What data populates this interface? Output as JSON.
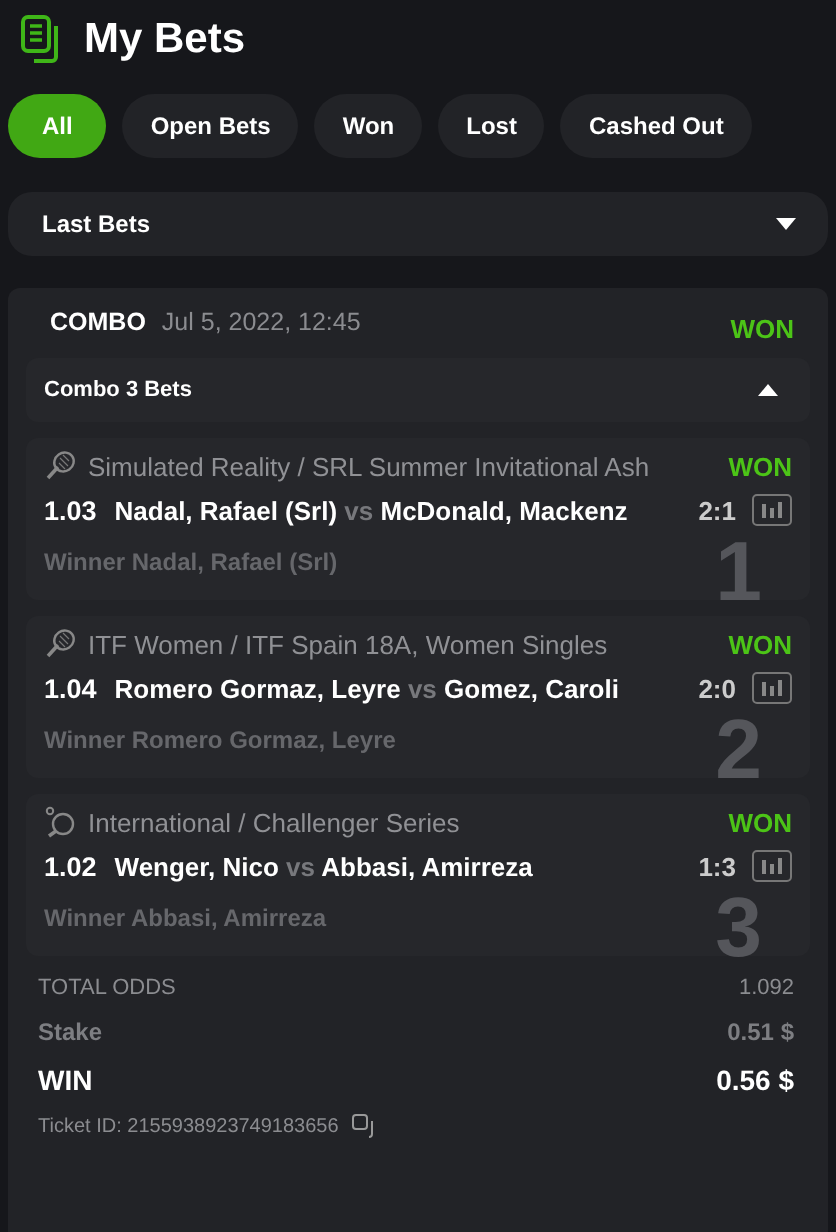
{
  "header": {
    "title": "My Bets"
  },
  "tabs": [
    {
      "label": "All",
      "selected": true
    },
    {
      "label": "Open Bets",
      "selected": false
    },
    {
      "label": "Won",
      "selected": false
    },
    {
      "label": "Lost",
      "selected": false
    },
    {
      "label": "Cashed Out",
      "selected": false
    }
  ],
  "filter": {
    "value": "Last Bets"
  },
  "bet": {
    "type": "COMBO",
    "date": "Jul 5, 2022, 12:45",
    "status": "WON",
    "group": {
      "label": "Combo 3 Bets",
      "expanded": true
    },
    "legs": [
      {
        "kind": "tennis",
        "tournament": "Simulated Reality / SRL Summer Invitational Ash",
        "status": "WON",
        "odds": "1.03",
        "home": "Nadal, Rafael (Srl)",
        "vs": "vs",
        "away": "McDonald, Mackenz",
        "score": "2:1",
        "pick": "Winner Nadal, Rafael (Srl)",
        "index": "1"
      },
      {
        "kind": "tennis",
        "tournament": "ITF Women / ITF Spain 18A, Women Singles",
        "status": "WON",
        "odds": "1.04",
        "home": "Romero Gormaz, Leyre",
        "vs": "vs",
        "away": "Gomez, Caroli",
        "score": "2:0",
        "pick": "Winner Romero Gormaz, Leyre",
        "index": "2"
      },
      {
        "kind": "table_tennis",
        "tournament": "International / Challenger Series",
        "status": "WON",
        "odds": "1.02",
        "home": "Wenger, Nico",
        "vs": "vs",
        "away": "Abbasi, Amirreza",
        "score": "1:3",
        "pick": "Winner Abbasi, Amirreza",
        "index": "3"
      }
    ],
    "total_odds": {
      "label": "TOTAL ODDS",
      "value": "1.092"
    },
    "stake": {
      "label": "Stake",
      "value": "0.51 $"
    },
    "win": {
      "label": "WIN",
      "value": "0.56 $"
    },
    "ticket": "Ticket ID: 2155938923749183656"
  }
}
